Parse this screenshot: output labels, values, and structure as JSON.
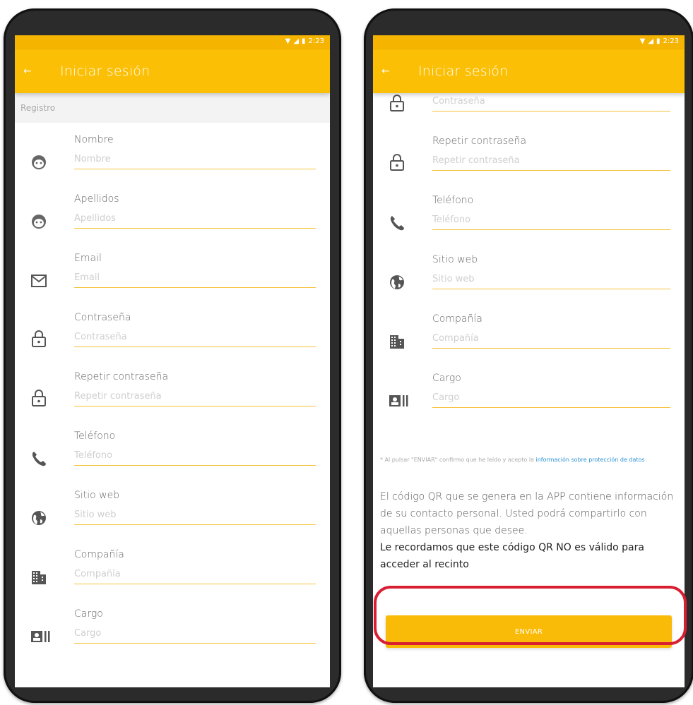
{
  "statusbar": {
    "time": "2:23"
  },
  "appbar": {
    "title": "Iniciar sesión"
  },
  "section": {
    "title": "Registro"
  },
  "fields": {
    "nombre": {
      "label": "Nombre",
      "placeholder": "Nombre"
    },
    "apellidos": {
      "label": "Apellidos",
      "placeholder": "Apellidos"
    },
    "email": {
      "label": "Email",
      "placeholder": "Email"
    },
    "password": {
      "label": "Contraseña",
      "placeholder": "Contraseña"
    },
    "repeat": {
      "label": "Repetir contraseña",
      "placeholder": "Repetir contraseña"
    },
    "phone": {
      "label": "Teléfono",
      "placeholder": "Teléfono"
    },
    "web": {
      "label": "Sitio web",
      "placeholder": "Sitio web"
    },
    "company": {
      "label": "Compañía",
      "placeholder": "Compañía"
    },
    "position": {
      "label": "Cargo",
      "placeholder": "Cargo"
    }
  },
  "legal": {
    "prefix": "* Al pulsar \"ENVIAR\" confirmo que he leído y acepto la ",
    "link": "información sobre protección de datos"
  },
  "info": {
    "text": "El código QR que se genera en la APP contiene información de su contacto personal. Usted podrá compartirlo con aquellas personas que desee.",
    "warning": "Le recordamos que este código QR NO es válido para acceder al recinto"
  },
  "submit": {
    "label": "ENVIAR"
  },
  "colors": {
    "accent": "#fbbf05",
    "underline": "#f6c23a",
    "highlight": "#d81e31"
  }
}
